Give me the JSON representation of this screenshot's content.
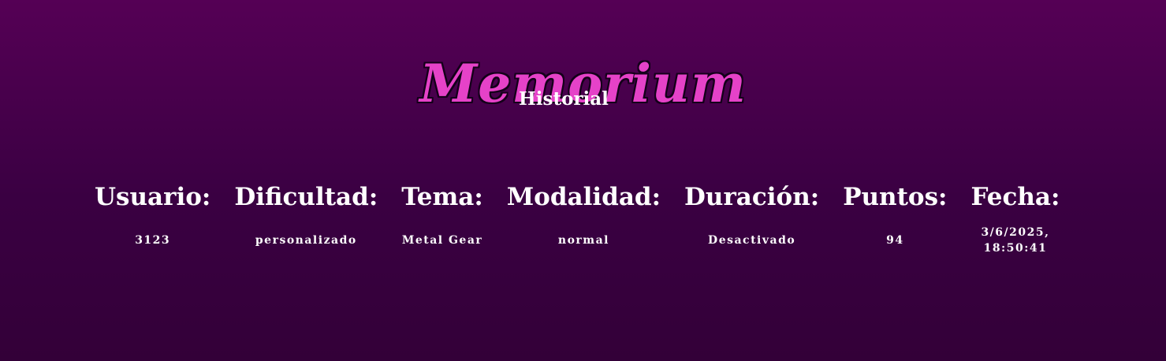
{
  "app": {
    "title": "Memorium",
    "subtitle": "Historial"
  },
  "table": {
    "headers": {
      "usuario": "Usuario:",
      "dificultad": "Dificultad:",
      "tema": "Tema:",
      "modalidad": "Modalidad:",
      "duracion": "Duración:",
      "puntos": "Puntos:",
      "fecha": "Fecha:"
    },
    "rows": [
      {
        "usuario": "3123",
        "dificultad": "personalizado",
        "tema": "Metal Gear",
        "modalidad": "normal",
        "duracion": "Desactivado",
        "puntos": "94",
        "fecha": "3/6/2025, 18:50:41"
      }
    ]
  },
  "colors": {
    "background_top": "#550055",
    "background_bottom": "#330038",
    "title_fill": "#e542c8",
    "title_outline": "#14001a",
    "text": "#ffffff"
  }
}
